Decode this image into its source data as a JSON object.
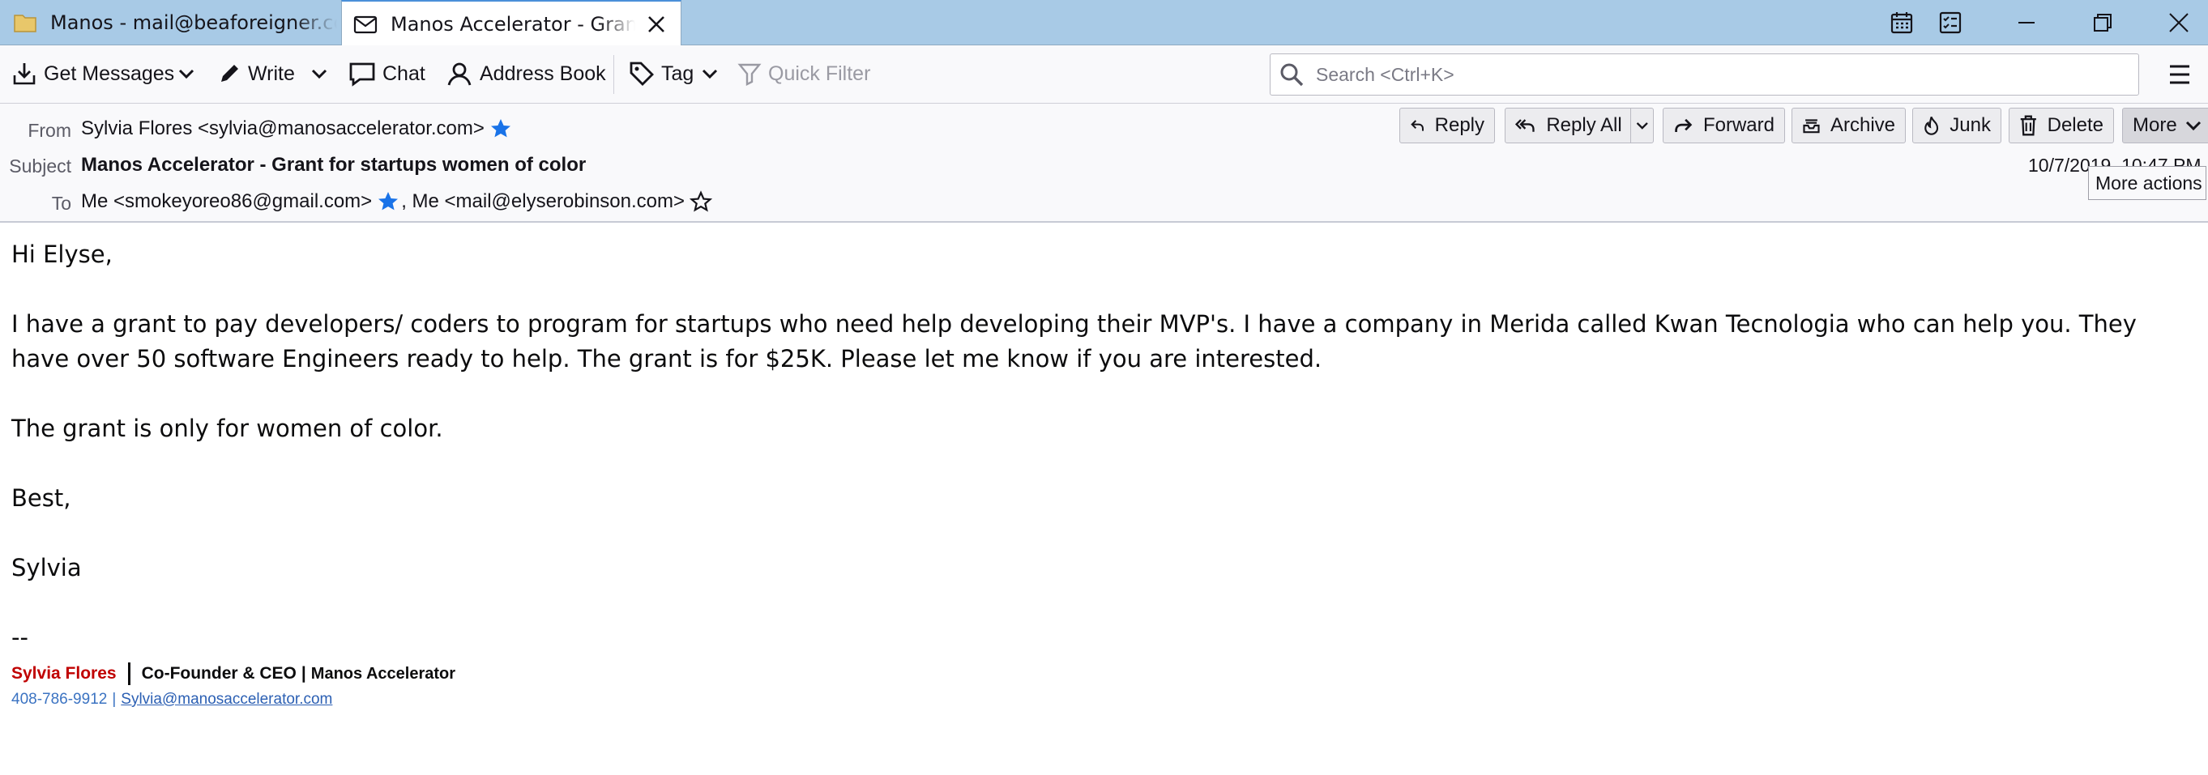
{
  "tabs": [
    {
      "label": "Manos - mail@beaforeigner.com",
      "icon": "folder-icon",
      "active": false
    },
    {
      "label": "Manos Accelerator - Grant for startups women of color",
      "icon": "envelope-icon",
      "active": true
    }
  ],
  "window_controls": [
    "calendar-icon",
    "tasks-icon",
    "minimize-icon",
    "restore-icon",
    "close-icon"
  ],
  "toolbar": {
    "get_messages": "Get Messages",
    "write": "Write",
    "chat": "Chat",
    "address_book": "Address Book",
    "tag": "Tag",
    "quick_filter": "Quick Filter",
    "search_placeholder": "Search <Ctrl+K>"
  },
  "header": {
    "from_label": "From",
    "from_value": "Sylvia Flores <sylvia@manosaccelerator.com>",
    "subject_label": "Subject",
    "subject_value": "Manos Accelerator - Grant for startups women of color",
    "to_label": "To",
    "to_first": "Me <smokeyoreo86@gmail.com>",
    "to_second": ", Me <mail@elyserobinson.com>",
    "date": "10/7/2019, 10:47 PM",
    "tooltip": "More actions",
    "actions": {
      "reply": "Reply",
      "reply_all": "Reply All",
      "forward": "Forward",
      "archive": "Archive",
      "junk": "Junk",
      "delete": "Delete",
      "more": "More"
    }
  },
  "body": {
    "greeting": "Hi Elyse,",
    "paragraph1": "I have a grant to pay developers/ coders to program for startups who need help developing their MVP's.  I have a company in Merida called Kwan Tecnologia who can help you. They have over 50 software Engineers ready to help. The grant is for $25K. Please let me know if you are interested.",
    "paragraph2": "The grant is only for women of color.",
    "closing": "Best,",
    "name": "Sylvia",
    "separator": "--"
  },
  "signature": {
    "name": "Sylvia Flores",
    "role": "Co-Founder & CEO",
    "divider": "|",
    "company": "Manos Accelerator",
    "phone": "408-786-9912",
    "phone_sep": "|",
    "email": "Sylvia@manosaccelerator.com"
  },
  "colors": {
    "tab_strip": "#a8cae6",
    "star_filled": "#1a73e8",
    "signature_name": "#c00000",
    "link": "#2b5fb3"
  }
}
